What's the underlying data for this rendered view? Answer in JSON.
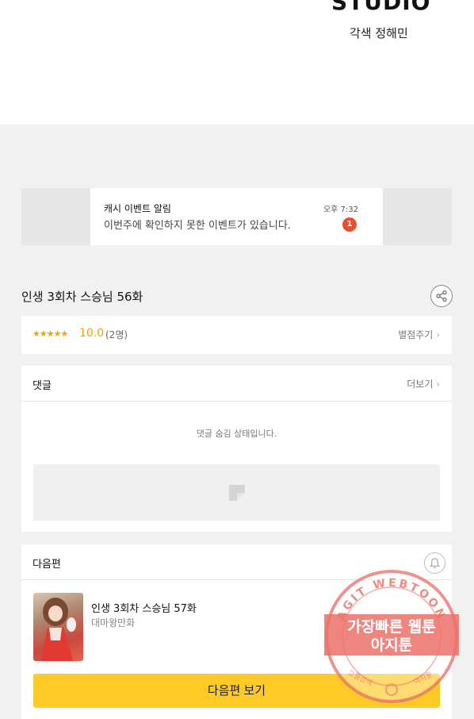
{
  "header": {
    "studio_logo_text": "STUDIO",
    "credit": "각색 정해민"
  },
  "notification": {
    "title": "캐시 이벤트 알림",
    "time": "오후 7:32",
    "message": "이번주에 확인하지 못한 이벤트가 있습니다.",
    "badge_count": "1",
    "badge_color": "#e5512a"
  },
  "episode": {
    "title": "인생 3회차 스승님 56화",
    "share_icon": "share-icon"
  },
  "rating": {
    "stars": "★★★★★",
    "score": "10.0",
    "count": "(2명)",
    "rate_link": "별점주기",
    "accent_color": "#f2a10b"
  },
  "comments": {
    "header": "댓글",
    "more_link": "더보기",
    "hidden_message": "댓글 숨김 상태입니다."
  },
  "next_episode": {
    "header": "다음편",
    "bell_icon": "bell-icon",
    "title": "인생 3회차 스승님 57화",
    "author": "대마왕만화",
    "button_label": "다음편 보기",
    "button_color": "#ffc926"
  },
  "watermark": {
    "ring_text": "AGIT WEBTOON",
    "line1": "가장빠른 웹툰",
    "line2": "아지툰",
    "bottom_left": "고퀄검색",
    "bottom_right": "아지툰"
  }
}
